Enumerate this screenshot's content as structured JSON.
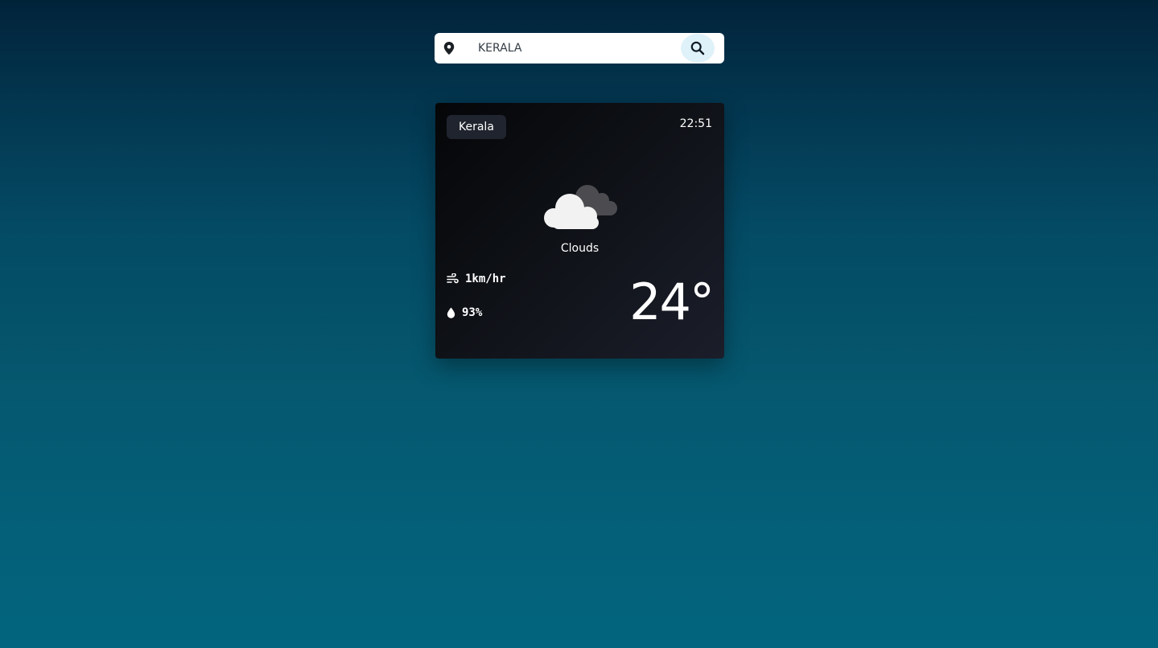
{
  "search": {
    "value": "KERALA",
    "placeholder": ""
  },
  "icons": {
    "location": "map-pin-icon",
    "search": "search-icon",
    "weather": "clouds-icon",
    "wind": "wind-icon",
    "humidity": "droplet-icon"
  },
  "card": {
    "location": "Kerala",
    "time": "22:51",
    "condition": "Clouds",
    "wind": "1km/hr",
    "humidity": "93%",
    "temperature": "24°"
  },
  "colors": {
    "background_top": "#01233a",
    "background_bottom": "#03657f",
    "search_button_bg": "#dff1f9",
    "card_bg": "#0e1116",
    "pill_bg": "#20242e"
  }
}
